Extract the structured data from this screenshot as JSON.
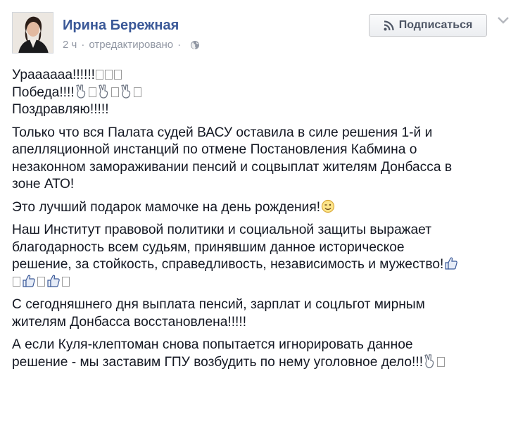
{
  "post": {
    "author": "Ирина Бережная",
    "time": "2 ч",
    "separator": "·",
    "edited": "отредактировано",
    "separator2": "·",
    "subscribe_label": "Подписаться",
    "lines": {
      "l1": "Ураааааа!!!!!!",
      "l2": "Победа!!!!",
      "l3": "Поздравляю!!!!!",
      "p2a": "Только что вся Палата судей ВАСУ оставила в силе решения 1-й и",
      "p2b": "апелляционной инстанций по отмене Постановления Кабмина о",
      "p2c": "незаконном замораживании пенсий и соцвыплат жителям Донбасса в",
      "p2d": "зоне АТО!",
      "p3": "Это лучший подарок мамочке на день рождения!",
      "p4a": "Наш Институт правовой политики и социальной защиты выражает",
      "p4b": "благодарность всем судьям, принявшим данное историческое",
      "p4c": "решение, за стойкость, справедливость, независимость и мужество!",
      "p5a": "С сегодняшнего дня выплата пенсий, зарплат и соцльгот мирным",
      "p5b": "жителям Донбасса восстановлена!!!!!",
      "p6a": "А если Куля-клептоман снова попытается игнорировать данное",
      "p6b": "решение - мы заставим ГПУ возбудить по нему уголовное дело!!!"
    },
    "icons": {
      "victory": "victory-hand-icon",
      "thumbs": "thumbs-up-icon",
      "wink": "wink-face-icon",
      "missing": "missing-glyph-icon"
    },
    "colors": {
      "author": "#3b5998",
      "meta": "#9197a3",
      "text": "#141823"
    }
  }
}
